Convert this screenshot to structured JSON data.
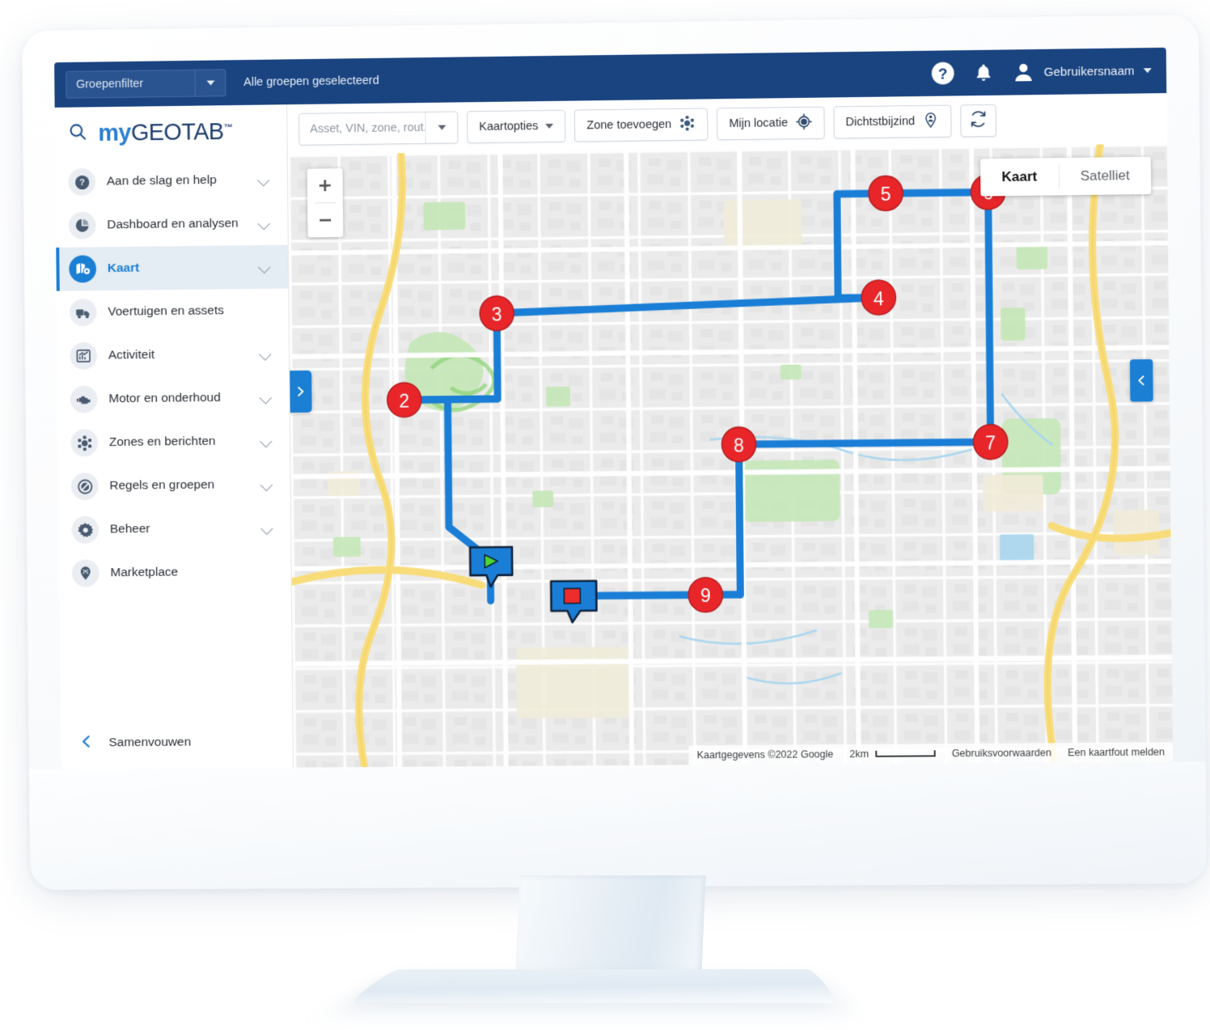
{
  "top_bar": {
    "group_filter_label": "Groepenfilter",
    "group_filter_status": "Alle groepen geselecteerd",
    "help_icon": "question-mark-circle-icon",
    "notifications_icon": "bell-icon",
    "avatar_icon": "user-avatar-icon",
    "username": "Gebruikersnaam",
    "user_caret_icon": "caret-down-icon"
  },
  "sidebar": {
    "search_icon": "search-icon",
    "brand_my": "my",
    "brand_geotab": "GEOTAB",
    "brand_tm": "™",
    "items": [
      {
        "label": "Aan de slag en help",
        "icon": "question-circle-icon",
        "expandable": true,
        "active": false
      },
      {
        "label": "Dashboard en analysen",
        "icon": "pie-chart-icon",
        "expandable": true,
        "active": false
      },
      {
        "label": "Kaart",
        "icon": "map-pin-icon",
        "expandable": true,
        "active": true
      },
      {
        "label": "Voertuigen en assets",
        "icon": "truck-icon",
        "expandable": false,
        "active": false
      },
      {
        "label": "Activiteit",
        "icon": "bar-chart-icon",
        "expandable": true,
        "active": false
      },
      {
        "label": "Motor en onderhoud",
        "icon": "engine-icon",
        "expandable": true,
        "active": false
      },
      {
        "label": "Zones en berichten",
        "icon": "zone-gear-icon",
        "expandable": true,
        "active": false
      },
      {
        "label": "Regels en groepen",
        "icon": "no-entry-icon",
        "expandable": true,
        "active": false
      },
      {
        "label": "Beheer",
        "icon": "gear-icon",
        "expandable": true,
        "active": false
      },
      {
        "label": "Marketplace",
        "icon": "marketplace-pin-icon",
        "expandable": false,
        "active": false
      }
    ],
    "collapse_label": "Samenvouwen",
    "collapse_icon": "chevron-left-icon"
  },
  "map_toolbar": {
    "search_value": "",
    "search_placeholder": "Asset, VIN, zone, rout...",
    "search_caret_icon": "caret-down-icon",
    "map_options_label": "Kaartopties",
    "map_options_caret_icon": "caret-down-icon",
    "add_zone_label": "Zone toevoegen",
    "add_zone_icon": "zone-gear-icon",
    "my_location_label": "Mijn locatie",
    "my_location_icon": "crosshair-icon",
    "nearest_label": "Dichtstbijzind",
    "nearest_icon": "location-person-icon",
    "refresh_icon": "refresh-icon"
  },
  "map": {
    "zoom_in_icon": "plus-icon",
    "zoom_out_icon": "minus-icon",
    "maptype_map_label": "Kaart",
    "maptype_satellite_label": "Satelliet",
    "maptype_selected": "Kaart",
    "panel_tab_left_icon": "chevron-right-icon",
    "panel_tab_right_icon": "chevron-left-icon",
    "route_color": "#1a7ed6",
    "marker_color": "#e8262a",
    "start_marker": {
      "icon": "play-triangle-icon",
      "color": "#4bd633"
    },
    "stop_marker": {
      "icon": "stop-square-icon",
      "color": "#ee2c2c"
    },
    "stop_numbers": [
      "2",
      "3",
      "4",
      "5",
      "6",
      "7",
      "8",
      "9"
    ],
    "footer": {
      "attribution": "Kaartgegevens ©2022 Google",
      "scale_label": "2km",
      "terms_label": "Gebruiksvoorwaarden",
      "report_label": "Een kaartfout melden"
    }
  }
}
